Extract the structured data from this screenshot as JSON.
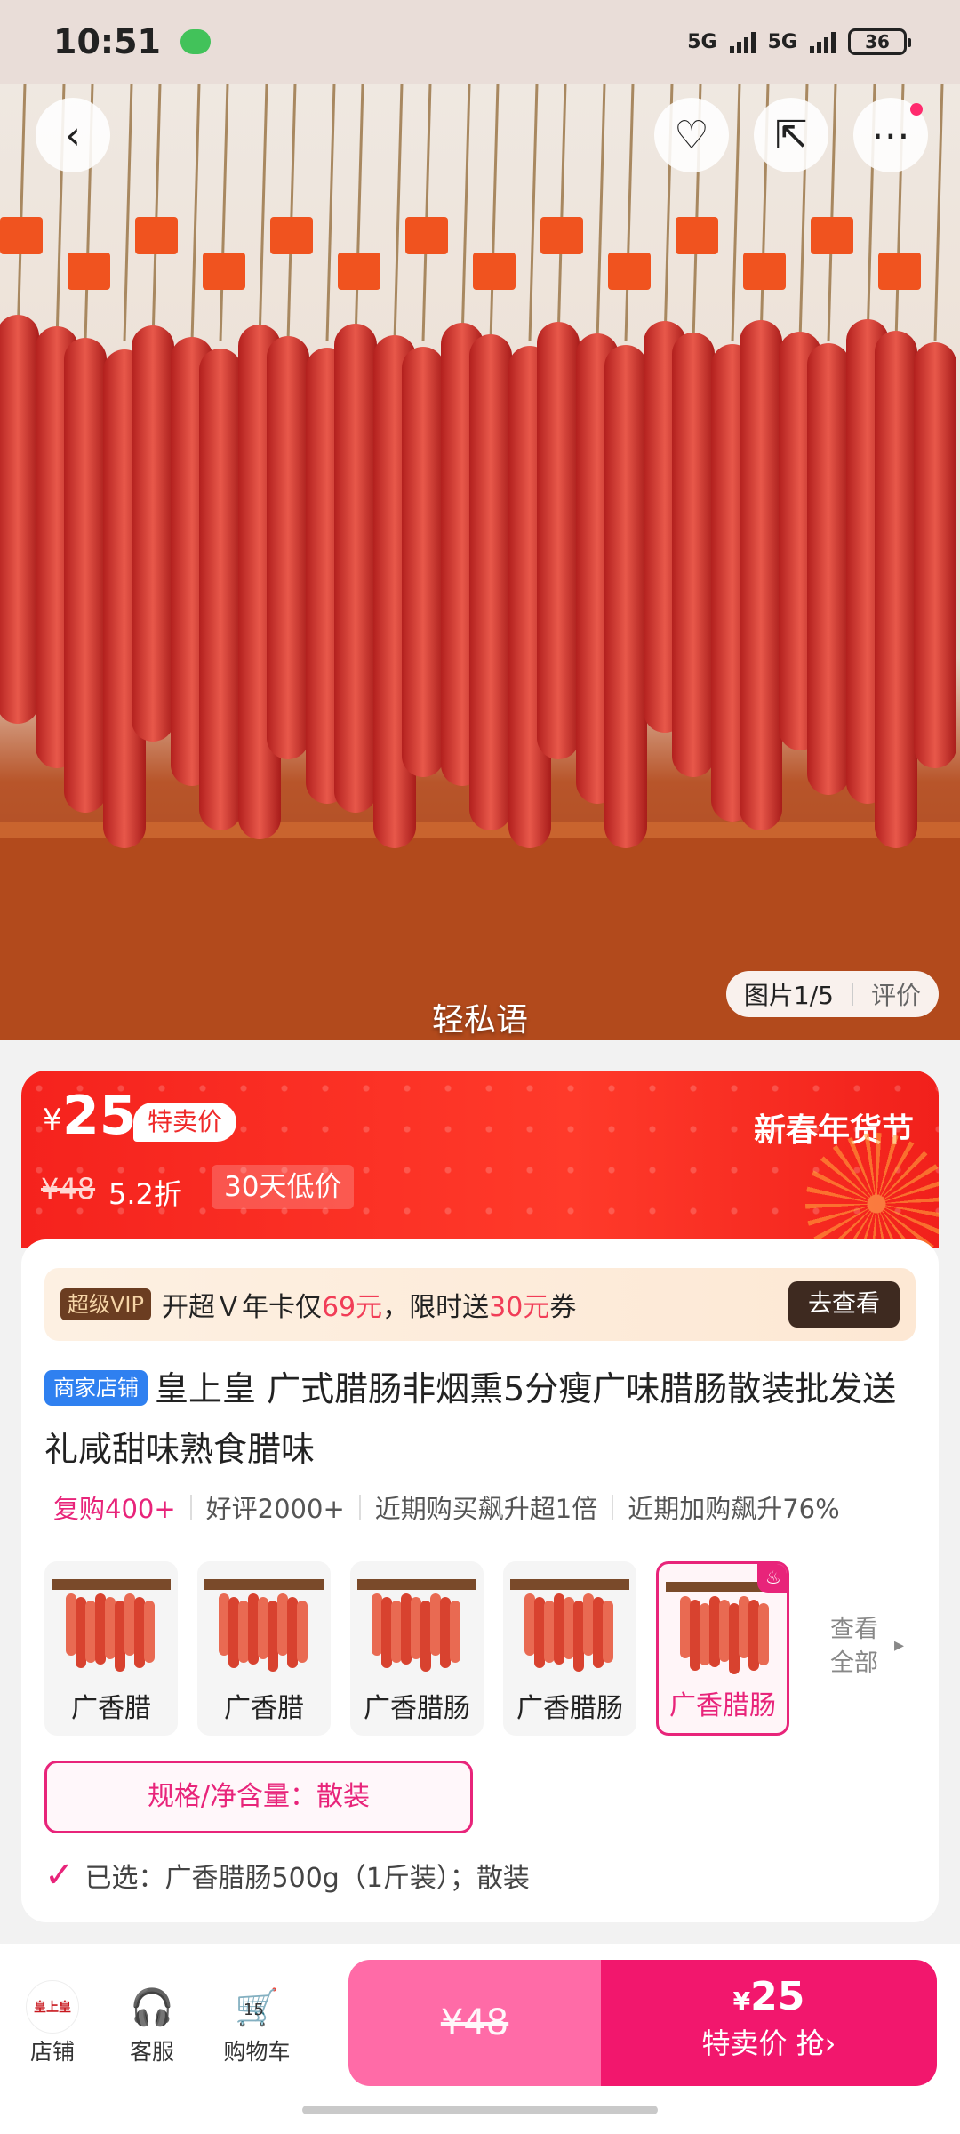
{
  "status_bar": {
    "time": "10:51",
    "signal1": "5G",
    "signal2": "5G",
    "battery": "36"
  },
  "hero": {
    "watermark": "轻私语",
    "image_counter": "图片1/5",
    "review_tab": "评价",
    "icons": [
      "back-icon",
      "favorite-add-icon",
      "share-icon",
      "more-icon"
    ]
  },
  "price_banner": {
    "currency": "¥",
    "price": "25",
    "special_tag": "特卖价",
    "original_price": "¥48",
    "discount": "5.2折",
    "low_price_tag": "30天低价",
    "festival": "新春年货节"
  },
  "vip": {
    "badge": "超级VIP",
    "text_before": "开超Ｖ年卡仅",
    "price1": "69元",
    "text_middle": "，限时送",
    "price2": "30元",
    "text_after": "券",
    "button": "去查看"
  },
  "product": {
    "shop_tag": "商家店铺",
    "title": "皇上皇 广式腊肠非烟熏5分瘦广味腊肠散装批发送礼咸甜味熟食腊味"
  },
  "stats": [
    "复购400+",
    "好评2000+",
    "近期购买飙升超1倍",
    "近期加购飙升76%"
  ],
  "variants": [
    {
      "label": "广香腊",
      "selected": false
    },
    {
      "label": "广香腊",
      "selected": false
    },
    {
      "label": "广香腊肠",
      "selected": false
    },
    {
      "label": "广香腊肠",
      "selected": false
    },
    {
      "label": "广香腊肠",
      "selected": true
    }
  ],
  "see_all": {
    "line1": "查看",
    "line2": "全部"
  },
  "spec_button": "规格/净含量：散装",
  "selected_text": "已选：广香腊肠500g（1斤装）；散装",
  "bottom": {
    "shop_label": "店铺",
    "shop_logo": "皇上皇",
    "service_label": "客服",
    "cart_label": "购物车",
    "cart_count": "15",
    "buy_normal": "¥48",
    "buy_special_currency": "¥",
    "buy_special_price": "25",
    "buy_special_label": "特卖价 抢›"
  },
  "colors": {
    "accent": "#e8247a",
    "banner_red": "#f5221d",
    "vip_brown": "#3e2a20",
    "buy_pink": "#f2176d"
  }
}
